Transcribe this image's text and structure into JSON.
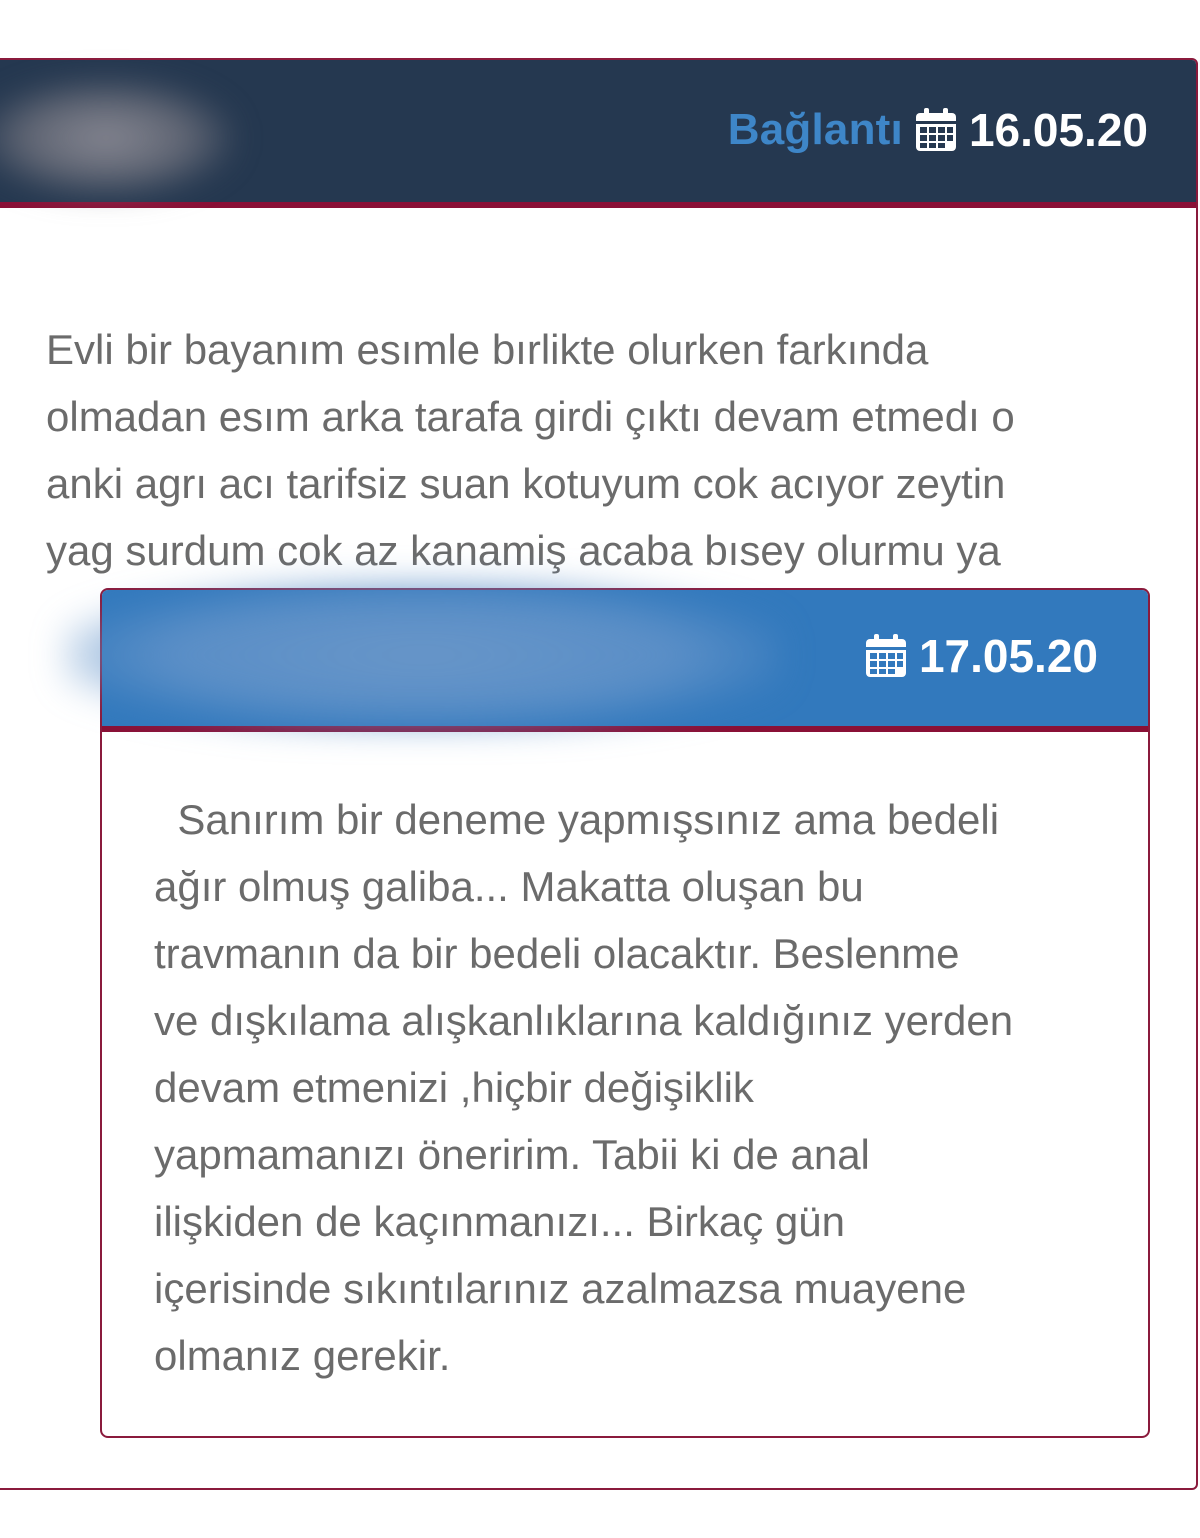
{
  "question": {
    "header": {
      "link_label": "Bağlantı",
      "date": "16.05.20",
      "date_icon": "calendar-icon",
      "background_color": "#253850",
      "accent_color": "#8a1036"
    },
    "body_lines": [
      "Evli bir bayanım esımle bırlikte olurken farkında",
      "olmadan esım arka tarafa girdi çıktı devam etmedı o",
      "anki agrı acı tarifsiz suan kotuyum cok acıyor zeytin",
      "yag surdum cok az kanamiş acaba bısey olurmu ya"
    ]
  },
  "answer": {
    "header": {
      "date": "17.05.20",
      "date_icon": "calendar-icon",
      "background_color": "#3279bd"
    },
    "body_lines": [
      "  Sanırım bir deneme yapmışsınız ama bedeli",
      "ağır olmuş galiba... Makatta oluşan bu",
      "travmanın da bir bedeli olacaktır. Beslenme",
      "ve dışkılama alışkanlıklarına kaldığınız yerden",
      "devam etmenizi ,hiçbir değişiklik",
      "yapmamanızı öneririm. Tabii ki de anal",
      "ilişkiden de kaçınmanızı... Birkaç gün",
      "içerisinde sıkıntılarınız azalmazsa muayene",
      "olmanız gerekir."
    ]
  }
}
